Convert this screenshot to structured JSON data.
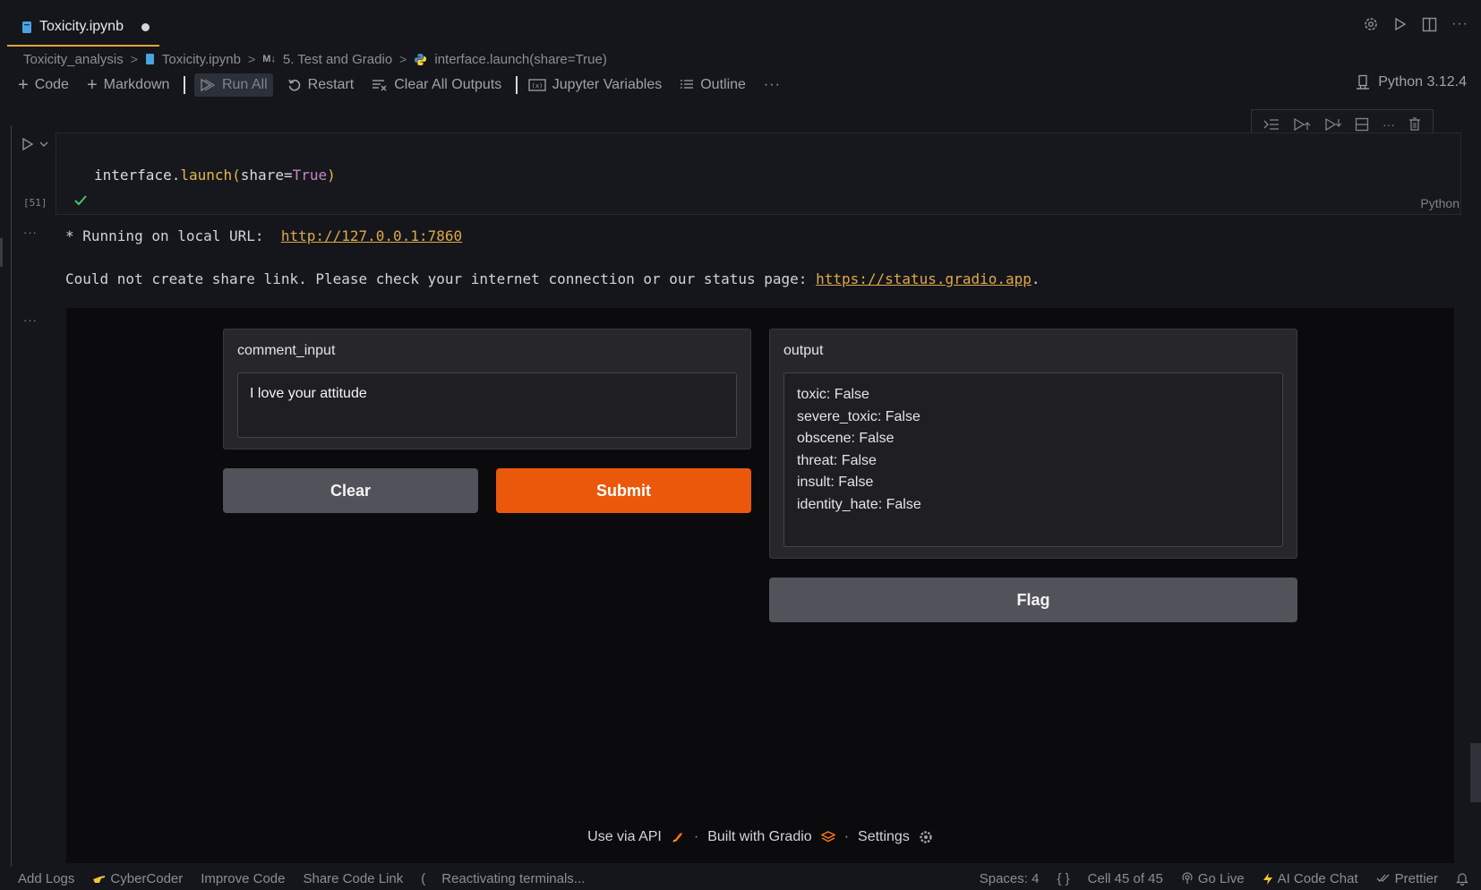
{
  "tab": {
    "title": "Toxicity.ipynb"
  },
  "breadcrumb": {
    "folder": "Toxicity_analysis",
    "file": "Toxicity.ipynb",
    "md_badge": "M↓",
    "section": "5. Test and Gradio",
    "symbol": "interface.launch(share=True)"
  },
  "toolbar": {
    "code": "Code",
    "markdown": "Markdown",
    "run_all": "Run All",
    "restart": "Restart",
    "clear_outputs": "Clear All Outputs",
    "variables": "Jupyter Variables",
    "outline": "Outline",
    "more": "···",
    "kernel": "Python 3.12.4"
  },
  "cell": {
    "code_obj": "interface",
    "code_dot": ".",
    "code_fn": "launch",
    "code_open": "(",
    "code_kw": "share",
    "code_eq": "=",
    "code_val": "True",
    "code_close": ")",
    "exec_count": "[51]",
    "language": "Python"
  },
  "output": {
    "dots": "···",
    "line1_prefix": "* Running on local URL:  ",
    "line1_link": "http://127.0.0.1:7860",
    "line2_prefix": "Could not create share link. Please check your internet connection or our status page: ",
    "line2_link": "https://status.gradio.app",
    "line2_suffix": "."
  },
  "gradio": {
    "input_label": "comment_input",
    "input_value": "I love your attitude",
    "clear_label": "Clear",
    "submit_label": "Submit",
    "output_label": "output",
    "output_lines": [
      "toxic: False",
      "severe_toxic: False",
      "obscene: False",
      "threat: False",
      "insult: False",
      "identity_hate: False"
    ],
    "flag_label": "Flag",
    "footer": {
      "api": "Use via API",
      "sep": "·",
      "built": "Built with Gradio",
      "settings": "Settings"
    }
  },
  "statusbar": {
    "add_logs": "Add Logs",
    "cybercoder": "CyberCoder",
    "improve": "Improve Code",
    "share": "Share Code Link",
    "spinner": "(",
    "reactivating": "Reactivating terminals...",
    "spaces": "Spaces: 4",
    "braces": "{ }",
    "cell_pos": "Cell 45 of 45",
    "go_live": "Go Live",
    "ai_chat": "AI Code Chat",
    "prettier": "Prettier"
  },
  "colors": {
    "accent_tab": "#e5a33b",
    "gradio_primary": "#ea580c",
    "link": "#e0a84a",
    "keyword_fn": "#e5b84e",
    "keyword_const": "#c586c0"
  }
}
